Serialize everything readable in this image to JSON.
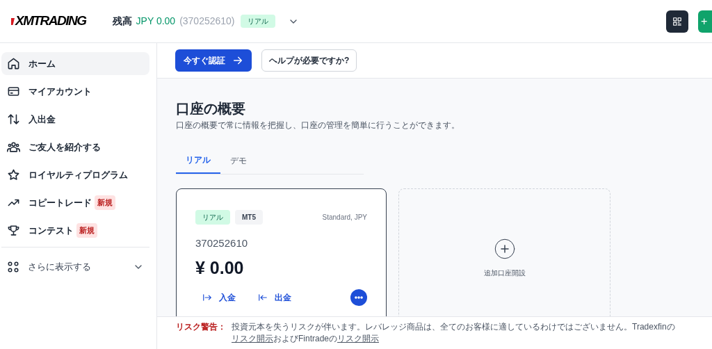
{
  "header": {
    "logo": "XMTRADING",
    "balance_label": "残高",
    "balance": "JPY 0.00",
    "account": "(370252610)",
    "account_badge": "リアル",
    "new_button": "+"
  },
  "action_bar": {
    "verify_button": "今すぐ認証",
    "help_button": "ヘルプが必要ですか?"
  },
  "sidebar": {
    "items": [
      {
        "kind": "home",
        "label": "ホーム",
        "selected": true
      },
      {
        "kind": "card",
        "label": "マイアカウント",
        "selected": false
      },
      {
        "kind": "transfer",
        "label": "入出金",
        "selected": false
      },
      {
        "kind": "users",
        "label": "ご友人を紹介する",
        "selected": false
      },
      {
        "kind": "star",
        "label": "ロイヤルティプログラム",
        "selected": false
      },
      {
        "kind": "trend",
        "label": "コピートレード",
        "badge": "新規",
        "selected": false
      },
      {
        "kind": "trophy",
        "label": "コンテスト",
        "badge": "新規",
        "selected": false
      }
    ],
    "more": {
      "label": "さらに表示する",
      "expanded": false
    }
  },
  "overview": {
    "title": "口座の概要",
    "subtitle": "口座の概要で常に情報を把握し、口座の管理を簡単に行うことができます。",
    "tabs": [
      {
        "label": "リアル",
        "selected": true
      },
      {
        "label": "デモ",
        "selected": false
      }
    ],
    "account_card": {
      "type_badge": "リアル",
      "platform_badge": "MT5",
      "plan": "Standard, JPY",
      "number": "370252610",
      "balance": "¥ 0.00",
      "deposit": "入金",
      "withdraw": "出金"
    },
    "add_account": "追加口座開設"
  },
  "footer": {
    "label": "リスク警告：",
    "parts": [
      {
        "kind": "text",
        "text": "投資元本を失うリスクが伴います。レバレッジ商品は、全てのお客様に適しているわけではございません。Tradexfinの"
      },
      {
        "kind": "link",
        "text": "リスク開示"
      },
      {
        "kind": "text",
        "text": "およびFintradeの"
      },
      {
        "kind": "link",
        "text": "リスク開示"
      }
    ]
  }
}
